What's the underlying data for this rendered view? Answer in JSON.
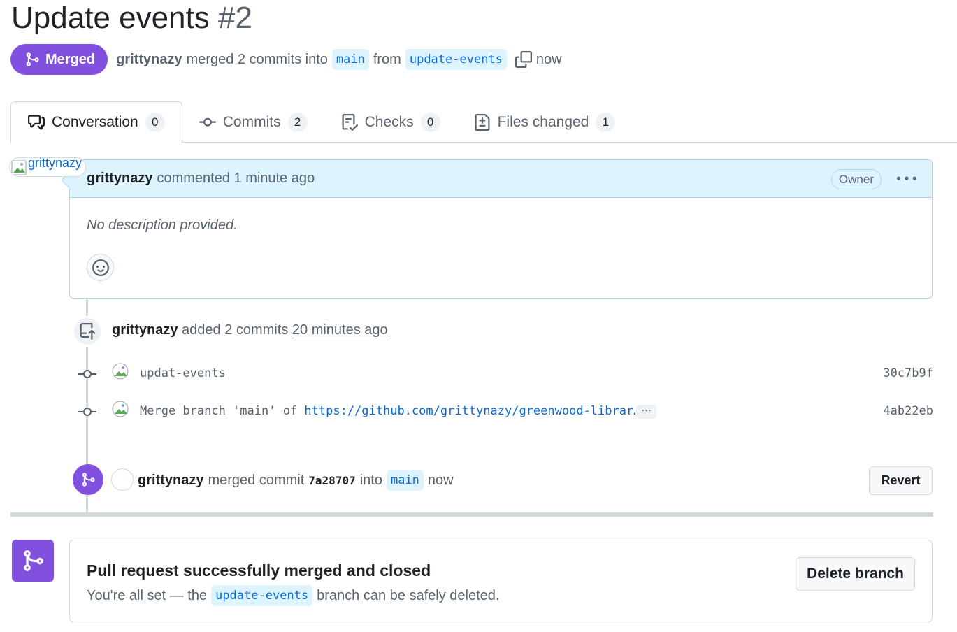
{
  "title": {
    "text": "Update events",
    "number": "#2"
  },
  "status_badge": {
    "label": "Merged",
    "icon": "git-merge-icon",
    "color": "#8250df"
  },
  "meta": {
    "author": "grittynazy",
    "merged_text": "merged 2 commits into",
    "base_branch": "main",
    "from_text": "from",
    "head_branch": "update-events",
    "time": "now"
  },
  "tabs": [
    {
      "label": "Conversation",
      "count": "0",
      "icon": "comment-discussion-icon"
    },
    {
      "label": "Commits",
      "count": "2",
      "icon": "git-commit-icon"
    },
    {
      "label": "Checks",
      "count": "0",
      "icon": "checklist-icon"
    },
    {
      "label": "Files changed",
      "count": "1",
      "icon": "file-diff-icon"
    }
  ],
  "comment": {
    "avatar_alt": "grittynazy",
    "author": "grittynazy",
    "action": "commented 1 minute ago",
    "role_badge": "Owner",
    "body": "No description provided."
  },
  "push_event": {
    "author": "grittynazy",
    "action": "added 2 commits",
    "time": "20 minutes ago"
  },
  "commits": [
    {
      "message": "updat-events",
      "link": "",
      "sha": "30c7b9f"
    },
    {
      "message": "Merge branch 'main' of ",
      "link": "https://github.com/grittynazy/greenwood-librar…",
      "sha": "4ab22eb"
    }
  ],
  "merge_event": {
    "author": "grittynazy",
    "action": "merged commit",
    "sha": "7a28707",
    "into_text": "into",
    "branch": "main",
    "time": "now",
    "revert_label": "Revert"
  },
  "merge_box": {
    "title": "Pull request successfully merged and closed",
    "sub_prefix": "You're all set — the",
    "branch": "update-events",
    "sub_suffix": "branch can be safely deleted.",
    "delete_label": "Delete branch"
  },
  "colors": {
    "merged": "#8250df",
    "link": "#0969da",
    "branch_bg": "#ddf4ff",
    "comment_header_bg": "#ddf4ff"
  }
}
